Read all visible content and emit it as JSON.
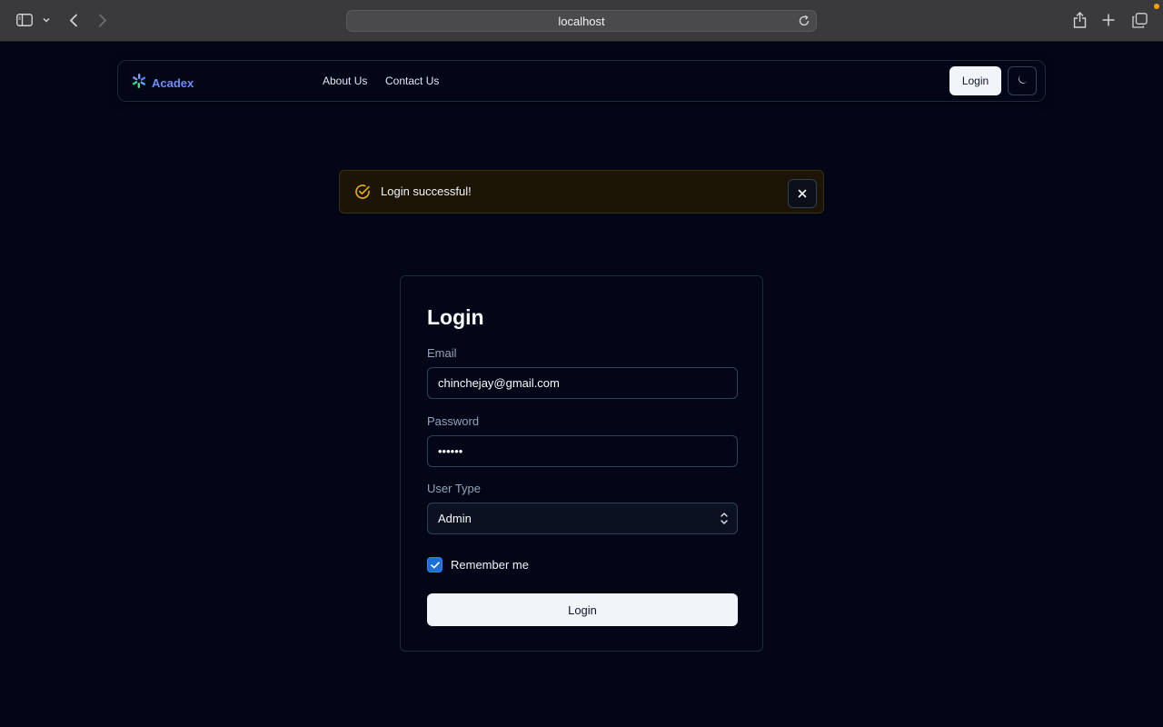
{
  "browser": {
    "url": "localhost"
  },
  "navbar": {
    "brand": "Acadex",
    "links": [
      {
        "label": "About Us"
      },
      {
        "label": "Contact Us"
      }
    ],
    "login_label": "Login"
  },
  "toast": {
    "message": "Login successful!",
    "accent": "#eab308"
  },
  "form": {
    "title": "Login",
    "email": {
      "label": "Email",
      "value": "chinchejay@gmail.com"
    },
    "password": {
      "label": "Password",
      "value": "••••••"
    },
    "user_type": {
      "label": "User Type",
      "value": "Admin"
    },
    "remember": {
      "label": "Remember me",
      "checked": true
    },
    "submit_label": "Login"
  },
  "colors": {
    "background": "#020617",
    "brand": "#6d8dfb",
    "checkbox": "#1d6fd8"
  }
}
